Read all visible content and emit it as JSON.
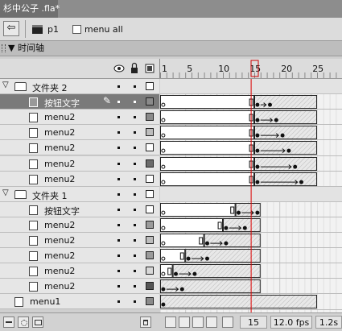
{
  "document": {
    "tab_title": "杉中公子 .fla*"
  },
  "edit_bar": {
    "back_icon": "arrow-left-icon",
    "scene_label": "p1",
    "symbol_label": "menu all"
  },
  "timeline": {
    "title": "时间轴",
    "ruler_labels": [
      "1",
      "5",
      "10",
      "15",
      "20",
      "25"
    ],
    "header_icons": [
      "eye-icon",
      "lock-icon",
      "outline-icon"
    ],
    "layers": [
      {
        "type": "folder",
        "name": "文件夹 2"
      },
      {
        "type": "layer",
        "name": "按钮文字",
        "selected": true,
        "pencil": true,
        "color": "#8a8a8a"
      },
      {
        "type": "layer",
        "name": "menu2",
        "color": "#8a8a8a"
      },
      {
        "type": "layer",
        "name": "menu2",
        "color": "#bdbdbd"
      },
      {
        "type": "layer",
        "name": "menu2",
        "color": "#ffffff"
      },
      {
        "type": "layer",
        "name": "menu2",
        "color": "#6a6a6a"
      },
      {
        "type": "layer",
        "name": "menu2",
        "color": "#ffffff"
      },
      {
        "type": "folder",
        "name": "文件夹 1"
      },
      {
        "type": "layer",
        "name": "按钮文字",
        "color": "#ffffff"
      },
      {
        "type": "layer",
        "name": "menu2",
        "color": "#9a9a9a"
      },
      {
        "type": "layer",
        "name": "menu2",
        "color": "#bdbdbd"
      },
      {
        "type": "layer",
        "name": "menu2",
        "color": "#9a9a9a"
      },
      {
        "type": "layer",
        "name": "menu2",
        "color": "#d8d8d8"
      },
      {
        "type": "layer",
        "name": "menu2",
        "color": "#555555"
      },
      {
        "type": "layer",
        "name": "menu1",
        "color": "#8a8a8a"
      }
    ]
  },
  "status": {
    "current_frame": "15",
    "frame_rate": "12.0 fps",
    "elapsed": "1.2s"
  }
}
